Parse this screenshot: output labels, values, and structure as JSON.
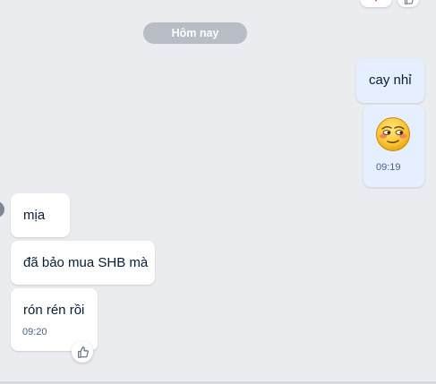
{
  "date_divider": {
    "label": "Hôm nay"
  },
  "messages": [
    {
      "side": "sent",
      "text": "cay nhỉ",
      "time": ""
    },
    {
      "side": "sent",
      "type": "emoji",
      "icon": "blushing-smirk-emoji",
      "time": "09:19"
    },
    {
      "side": "received",
      "text": "mịa",
      "time": ""
    },
    {
      "side": "received",
      "text": "đã bảo mua SHB mà",
      "time": ""
    },
    {
      "side": "received",
      "text": "rón rén rồi",
      "time": "09:20"
    }
  ],
  "reactions_top": {
    "icon": "heart-icon",
    "like_icon": "thumbs-up-icon"
  },
  "like_button": {
    "icon": "thumbs-up-icon"
  },
  "colors": {
    "background": "#ebecf0",
    "sent_bubble": "#e5efff",
    "received_bubble": "#ffffff",
    "date_pill": "#b7bcc5",
    "text": "#081c36",
    "time": "#476285"
  }
}
